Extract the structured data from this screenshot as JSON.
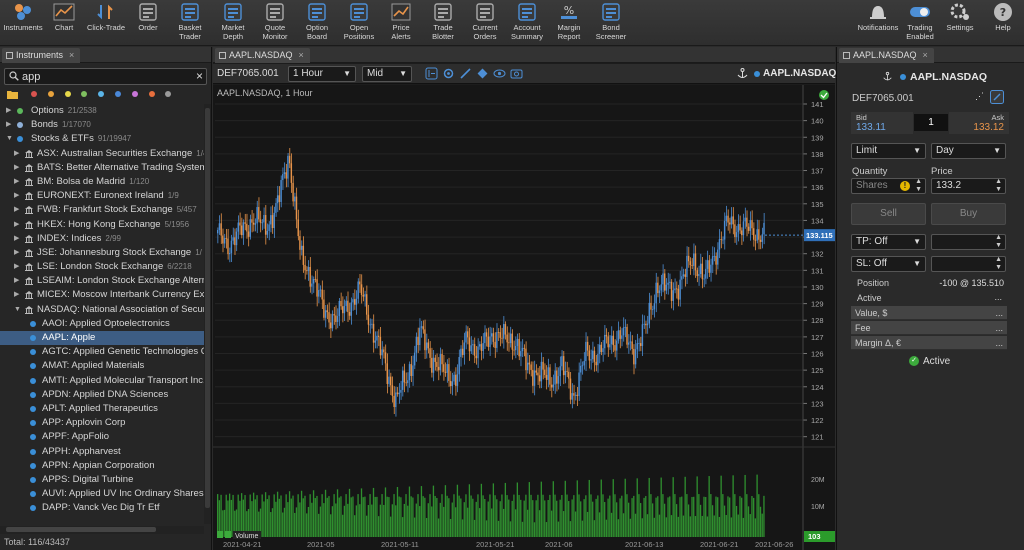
{
  "toolbar": {
    "left": [
      {
        "label": "Instruments",
        "icon": "instruments-icon"
      },
      {
        "label": "Chart",
        "icon": "chart-icon"
      },
      {
        "label": "Click-Trade",
        "icon": "click-trade-icon"
      },
      {
        "label": "Order",
        "icon": "order-icon"
      },
      {
        "label": "Basket\nTrader",
        "icon": "basket-icon"
      },
      {
        "label": "Market\nDepth",
        "icon": "market-depth-icon"
      },
      {
        "label": "Quote\nMonitor",
        "icon": "quote-monitor-icon"
      },
      {
        "label": "Option\nBoard",
        "icon": "option-board-icon"
      },
      {
        "label": "Open\nPositions",
        "icon": "open-positions-icon"
      },
      {
        "label": "Price\nAlerts",
        "icon": "price-alerts-icon"
      },
      {
        "label": "Trade\nBlotter",
        "icon": "trade-blotter-icon"
      },
      {
        "label": "Current\nOrders",
        "icon": "current-orders-icon"
      },
      {
        "label": "Account\nSummary",
        "icon": "account-summary-icon"
      },
      {
        "label": "Margin\nReport",
        "icon": "margin-report-icon"
      },
      {
        "label": "Bond\nScreener",
        "icon": "bond-screener-icon"
      }
    ],
    "right": [
      {
        "label": "Notifications",
        "icon": "bell-icon"
      },
      {
        "label": "Trading\nEnabled",
        "icon": "toggle-icon"
      },
      {
        "label": "Settings",
        "icon": "gear-icon"
      },
      {
        "label": "Help",
        "icon": "help-icon"
      }
    ]
  },
  "instruments": {
    "tab_label": "Instruments",
    "search_value": "app",
    "filter_colors": [
      "#d9534f",
      "#e8a33d",
      "#e6d84a",
      "#7fbf5f",
      "#5bb5e8",
      "#4a88d8",
      "#c875d8",
      "#e86f3d",
      "#9a9a9a"
    ],
    "tree": [
      {
        "level": 0,
        "arrow": "▶",
        "bullet": "#5cb85c",
        "label": "Options",
        "count": "21/2538"
      },
      {
        "level": 0,
        "arrow": "▶",
        "bullet": "#8fb0d8",
        "label": "Bonds",
        "count": "1/17070"
      },
      {
        "level": 0,
        "arrow": "▼",
        "bullet": "#3a8fd8",
        "label": "Stocks & ETFs",
        "count": "91/19947"
      },
      {
        "level": 1,
        "arrow": "▶",
        "icon": "exchange",
        "label": "ASX: Australian Securities Exchange",
        "count": "1/4"
      },
      {
        "level": 1,
        "arrow": "▶",
        "icon": "exchange",
        "label": "BATS: Better Alternative Trading System",
        "count": ""
      },
      {
        "level": 1,
        "arrow": "▶",
        "icon": "exchange",
        "label": "BM: Bolsa de Madrid",
        "count": "1/120"
      },
      {
        "level": 1,
        "arrow": "▶",
        "icon": "exchange",
        "label": "EURONEXT: Euronext Ireland",
        "count": "1/9"
      },
      {
        "level": 1,
        "arrow": "▶",
        "icon": "exchange",
        "label": "FWB: Frankfurt Stock Exchange",
        "count": "5/457"
      },
      {
        "level": 1,
        "arrow": "▶",
        "icon": "exchange",
        "label": "HKEX: Hong Kong Exchange",
        "count": "5/1956"
      },
      {
        "level": 1,
        "arrow": "▶",
        "icon": "exchange",
        "label": "INDEX: Indices",
        "count": "2/99"
      },
      {
        "level": 1,
        "arrow": "▶",
        "icon": "exchange",
        "label": "JSE: Johannesburg  Stock Exchange",
        "count": "1/"
      },
      {
        "level": 1,
        "arrow": "▶",
        "icon": "exchange",
        "label": "LSE: London Stock Exchange",
        "count": "6/2218"
      },
      {
        "level": 1,
        "arrow": "▶",
        "icon": "exchange",
        "label": "LSEAIM: London Stock Exchange Alterna",
        "count": ""
      },
      {
        "level": 1,
        "arrow": "▶",
        "icon": "exchange",
        "label": "MICEX: Moscow Interbank Currency Exc",
        "count": ""
      },
      {
        "level": 1,
        "arrow": "▼",
        "icon": "exchange",
        "label": "NASDAQ: National Association of Securi",
        "count": ""
      },
      {
        "level": 2,
        "bullet": "#3a8fd8",
        "label": "AAOI: Applied Optoelectronics",
        "count": ""
      },
      {
        "level": 2,
        "bullet": "#3a8fd8",
        "label": "AAPL: Apple",
        "count": "",
        "selected": true
      },
      {
        "level": 2,
        "bullet": "#3a8fd8",
        "label": "AGTC: Applied Genetic Technologies C",
        "count": ""
      },
      {
        "level": 2,
        "bullet": "#3a8fd8",
        "label": "AMAT: Applied Materials",
        "count": ""
      },
      {
        "level": 2,
        "bullet": "#3a8fd8",
        "label": "AMTI: Applied Molecular Transport Inc.",
        "count": ""
      },
      {
        "level": 2,
        "bullet": "#3a8fd8",
        "label": "APDN: Applied DNA Sciences",
        "count": ""
      },
      {
        "level": 2,
        "bullet": "#3a8fd8",
        "label": "APLT: Applied Therapeutics",
        "count": ""
      },
      {
        "level": 2,
        "bullet": "#3a8fd8",
        "label": "APP: Applovin Corp",
        "count": ""
      },
      {
        "level": 2,
        "bullet": "#3a8fd8",
        "label": "APPF: AppFolio",
        "count": ""
      },
      {
        "level": 2,
        "bullet": "#3a8fd8",
        "label": "APPH: Appharvest",
        "count": ""
      },
      {
        "level": 2,
        "bullet": "#3a8fd8",
        "label": "APPN: Appian Corporation",
        "count": ""
      },
      {
        "level": 2,
        "bullet": "#3a8fd8",
        "label": "APPS: Digital Turbine",
        "count": ""
      },
      {
        "level": 2,
        "bullet": "#3a8fd8",
        "label": "AUVI: Applied UV Inc Ordinary Shares",
        "count": ""
      },
      {
        "level": 2,
        "bullet": "#3a8fd8",
        "label": "DAPP: Vanck Vec Dig Tr Etf",
        "count": ""
      }
    ],
    "total": "Total: 116/43437"
  },
  "chart": {
    "tab_label": "AAPL.NASDAQ",
    "account": "DEF7065.001",
    "period": "1 Hour",
    "price_type": "Mid",
    "symbol": "AAPL.NASDAQ",
    "title": "AAPL.NASDAQ, 1 Hour",
    "current_price": "133.115",
    "volume_label": "Volume",
    "volume_value": "103",
    "up_color": "#4d8fd6",
    "down_color": "#e8944a"
  },
  "chart_data": {
    "type": "candlestick",
    "title": "AAPL.NASDAQ, 1 Hour",
    "ylim": [
      120.5,
      141.3
    ],
    "yticks": [
      121,
      122,
      123,
      124,
      125,
      126,
      127,
      128,
      129,
      130,
      131,
      132,
      133,
      134,
      135,
      136,
      137,
      138,
      139,
      140,
      141
    ],
    "xticks": [
      "2021-04-21",
      "2021-05",
      "2021-05-11",
      "2021-05-21",
      "2021-06",
      "2021-06-13",
      "2021-06-21",
      "2021-06-26"
    ],
    "price_path": [
      [
        "2021-04-21",
        133.1
      ],
      [
        "2021-04-22",
        132.6
      ],
      [
        "2021-04-23",
        133.4
      ],
      [
        "2021-04-26",
        134.1
      ],
      [
        "2021-04-27",
        133.6
      ],
      [
        "2021-04-28",
        134.8
      ],
      [
        "2021-04-29",
        138.0
      ],
      [
        "2021-04-30",
        131.6
      ],
      [
        "2021-05-03",
        130.6
      ],
      [
        "2021-05-04",
        128.4
      ],
      [
        "2021-05-05",
        128.2
      ],
      [
        "2021-05-06",
        128.9
      ],
      [
        "2021-05-07",
        129.8
      ],
      [
        "2021-05-10",
        127.6
      ],
      [
        "2021-05-11",
        125.5
      ],
      [
        "2021-05-12",
        123.2
      ],
      [
        "2021-05-13",
        124.6
      ],
      [
        "2021-05-14",
        127.3
      ],
      [
        "2021-05-17",
        125.8
      ],
      [
        "2021-05-18",
        124.9
      ],
      [
        "2021-05-19",
        124.5
      ],
      [
        "2021-05-20",
        127.0
      ],
      [
        "2021-05-21",
        126.0
      ],
      [
        "2021-05-24",
        127.2
      ],
      [
        "2021-05-25",
        126.9
      ],
      [
        "2021-05-26",
        126.8
      ],
      [
        "2021-05-27",
        125.3
      ],
      [
        "2021-05-28",
        124.8
      ],
      [
        "2021-06-01",
        124.4
      ],
      [
        "2021-06-02",
        125.1
      ],
      [
        "2021-06-03",
        123.5
      ],
      [
        "2021-06-04",
        125.9
      ],
      [
        "2021-06-07",
        126.0
      ],
      [
        "2021-06-08",
        126.7
      ],
      [
        "2021-06-09",
        127.2
      ],
      [
        "2021-06-10",
        126.2
      ],
      [
        "2021-06-11",
        127.4
      ],
      [
        "2021-06-14",
        130.2
      ],
      [
        "2021-06-15",
        129.8
      ],
      [
        "2021-06-16",
        130.2
      ],
      [
        "2021-06-17",
        131.8
      ],
      [
        "2021-06-18",
        130.4
      ],
      [
        "2021-06-21",
        132.3
      ],
      [
        "2021-06-22",
        133.9
      ],
      [
        "2021-06-23",
        133.6
      ],
      [
        "2021-06-24",
        133.4
      ],
      [
        "2021-06-25",
        133.1
      ]
    ],
    "volume_yticks": [
      "10M",
      "20M"
    ]
  },
  "order": {
    "tab_label": "AAPL.NASDAQ",
    "symbol": "AAPL.NASDAQ",
    "account": "DEF7065.001",
    "bid_label": "Bid",
    "bid": "133.11",
    "ask_label": "Ask",
    "ask": "133.12",
    "qty_stepper": "1",
    "order_type": "Limit",
    "tif": "Day",
    "quantity_label": "Quantity",
    "price_label": "Price",
    "quantity_placeholder": "Shares",
    "price": "133.2",
    "sell_label": "Sell",
    "buy_label": "Buy",
    "tp": "TP: Off",
    "sl": "SL: Off",
    "position_label": "Position",
    "position_value": "-100 @ 135.510",
    "active_label": "Active",
    "value_label": "Value, $",
    "fee_label": "Fee",
    "margin_label": "Margin Δ, €",
    "status": "Active",
    "ellipsis": "...",
    "bid_color": "#6fa8e8",
    "ask_color": "#e8944a"
  }
}
